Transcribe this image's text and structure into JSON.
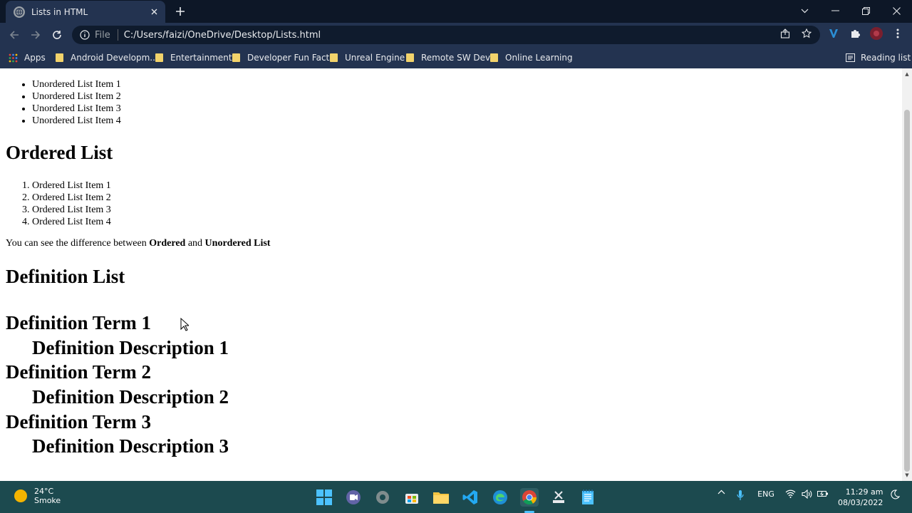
{
  "tab": {
    "title": "Lists in HTML"
  },
  "address": {
    "scheme": "File",
    "url": "C:/Users/faizi/OneDrive/Desktop/Lists.html"
  },
  "bookmarks": {
    "apps": "Apps",
    "items": [
      "Android Developm...",
      "Entertainment",
      "Developer Fun Facts",
      "Unreal Engine",
      "Remote SW Dev",
      "Online Learning"
    ],
    "reading_list": "Reading list"
  },
  "page": {
    "unordered": [
      "Unordered List Item 1",
      "Unordered List Item 2",
      "Unordered List Item 3",
      "Unordered List Item 4"
    ],
    "ordered_heading": "Ordered List",
    "ordered": [
      "Ordered List Item 1",
      "Ordered List Item 2",
      "Ordered List Item 3",
      "Ordered List Item 4"
    ],
    "para": {
      "before": "You can see the difference between ",
      "bold1": "Ordered",
      "middle": " and ",
      "bold2": "Unordered List"
    },
    "definition_heading": "Definition List",
    "terms": [
      "Definition Term 1",
      "Definition Term 2",
      "Definition Term 3"
    ],
    "descriptions": [
      "Definition Description 1",
      "Definition Description 2",
      "Definition Description 3"
    ]
  },
  "taskbar": {
    "weather": {
      "temp": "24°C",
      "desc": "Smoke"
    },
    "lang": "ENG",
    "time": "11:29 am",
    "date": "08/03/2022"
  },
  "colors": {
    "chrome_bg": "#233350",
    "tab_strip": "#0d1727",
    "taskbar": "#1c4a4f"
  }
}
